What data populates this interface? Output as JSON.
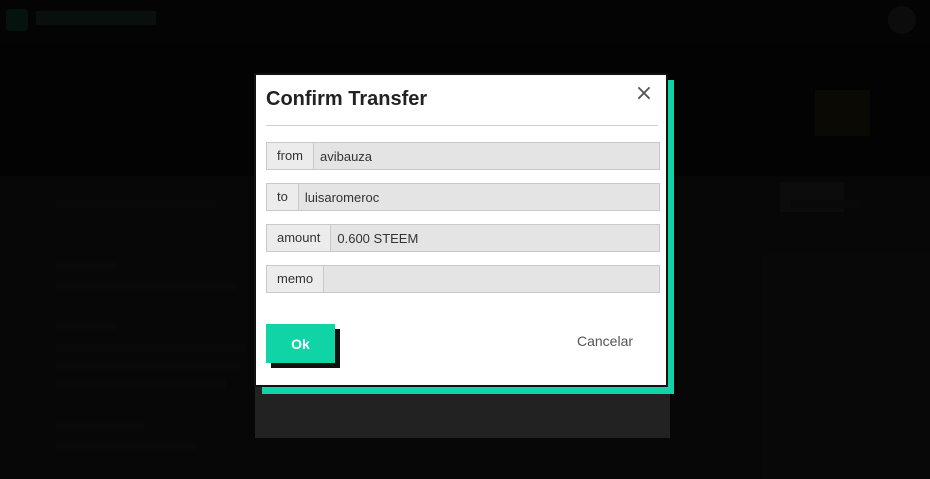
{
  "modal": {
    "title": "Confirm Transfer",
    "close_symbol": "×",
    "fields": {
      "from": {
        "label": "from",
        "value": "avibauza"
      },
      "to": {
        "label": "to",
        "value": "luisaromeroc"
      },
      "amount": {
        "label": "amount",
        "value": "0.600 STEEM"
      },
      "memo": {
        "label": "memo",
        "value": ""
      }
    },
    "ok_label": "Ok",
    "cancel_label": "Cancelar"
  },
  "colors": {
    "accent": "#10d4a6",
    "overlay": "#000000"
  },
  "icons": {
    "close": "close-icon",
    "logo": "steem-logo-icon"
  }
}
